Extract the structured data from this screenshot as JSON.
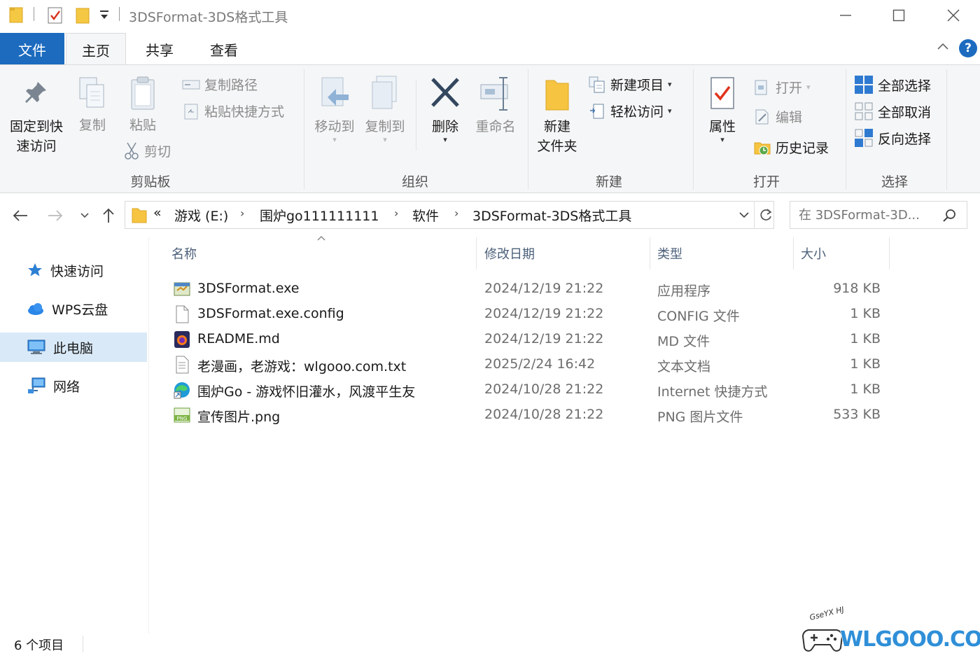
{
  "window": {
    "title": "3DSFormat-3DS格式工具",
    "controls": {
      "minimize": "—",
      "maximize": "☐",
      "close": "✕"
    }
  },
  "tabs": {
    "file": "文件",
    "home": "主页",
    "share": "共享",
    "view": "查看",
    "help": "?"
  },
  "ribbon": {
    "clipboard": {
      "label": "剪贴板",
      "pin": [
        "固定到快",
        "速访问"
      ],
      "copy": "复制",
      "paste": "粘贴",
      "copy_path": "复制路径",
      "paste_shortcut": "粘贴快捷方式",
      "cut": "剪切"
    },
    "organize": {
      "label": "组织",
      "move_to": "移动到",
      "copy_to": "复制到",
      "delete": "删除",
      "rename": "重命名"
    },
    "new": {
      "label": "新建",
      "new_folder": [
        "新建",
        "文件夹"
      ],
      "new_item": "新建项目",
      "easy_access": "轻松访问"
    },
    "open": {
      "label": "打开",
      "properties": "属性",
      "open": "打开",
      "edit": "编辑",
      "history": "历史记录"
    },
    "select": {
      "label": "选择",
      "select_all": "全部选择",
      "select_none": "全部取消",
      "invert": "反向选择"
    }
  },
  "address": {
    "overflow": "«",
    "crumbs": [
      "游戏 (E:)",
      "围炉go111111111",
      "软件",
      "3DSFormat-3DS格式工具"
    ],
    "search_placeholder": "在 3DSFormat-3D..."
  },
  "navpane": {
    "items": [
      {
        "label": "快速访问",
        "icon": "star-icon"
      },
      {
        "label": "WPS云盘",
        "icon": "cloud-icon"
      },
      {
        "label": "此电脑",
        "icon": "computer-icon"
      },
      {
        "label": "网络",
        "icon": "network-icon"
      }
    ]
  },
  "columns": {
    "name": "名称",
    "date": "修改日期",
    "type": "类型",
    "size": "大小"
  },
  "files": [
    {
      "name": "3DSFormat.exe",
      "date": "2024/12/19 21:22",
      "type": "应用程序",
      "size": "918 KB",
      "icon": "exe-icon"
    },
    {
      "name": "3DSFormat.exe.config",
      "date": "2024/12/19 21:22",
      "type": "CONFIG 文件",
      "size": "1 KB",
      "icon": "blank-file-icon"
    },
    {
      "name": "README.md",
      "date": "2024/12/19 21:22",
      "type": "MD 文件",
      "size": "1 KB",
      "icon": "firefox-icon"
    },
    {
      "name": "老漫画，老游戏：wlgooo.com.txt",
      "date": "2025/2/24 16:42",
      "type": "文本文档",
      "size": "1 KB",
      "icon": "text-file-icon"
    },
    {
      "name": "围炉Go - 游戏怀旧灌水，风渡平生友",
      "date": "2024/10/28 21:22",
      "type": "Internet 快捷方式",
      "size": "1 KB",
      "icon": "edge-icon"
    },
    {
      "name": "宣传图片.png",
      "date": "2024/10/28 21:22",
      "type": "PNG 图片文件",
      "size": "533 KB",
      "icon": "png-icon"
    }
  ],
  "status": {
    "count": "6 个项目"
  },
  "watermark": {
    "text": "WLGOOO.COM",
    "badge": "GseYX HJ"
  },
  "colors": {
    "accent": "#1c6bbf",
    "ribbon_bg": "#f5f6f7",
    "selected": "#d9e9f7",
    "muted_text": "#6d6d6d"
  }
}
